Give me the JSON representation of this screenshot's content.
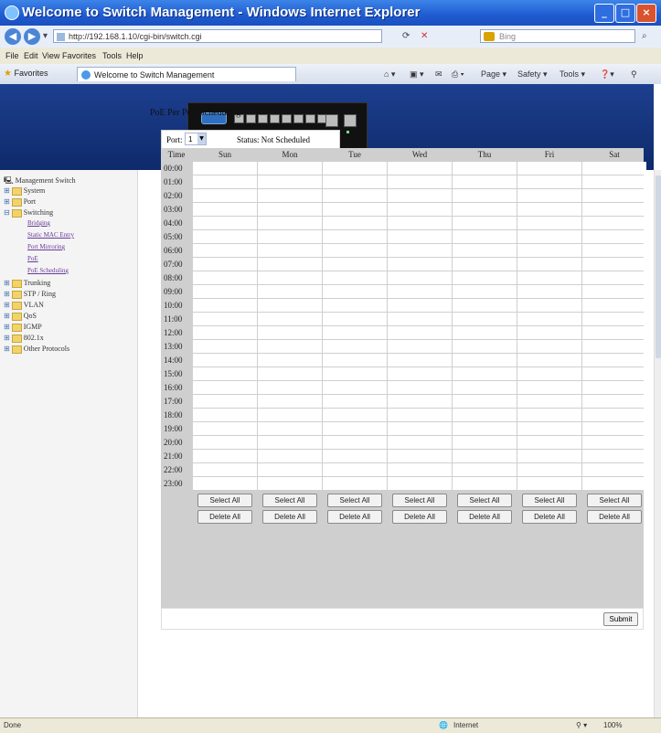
{
  "window": {
    "title": "Welcome to Switch Management - Windows Internet Explorer"
  },
  "address_bar": {
    "url": "http://192.168.1.10/cgi-bin/switch.cgi",
    "search_placeholder": "Bing"
  },
  "menu": [
    "File",
    "Edit",
    "View",
    "Favorites",
    "Tools",
    "Help"
  ],
  "favorites_bar": {
    "favorites_label": "Favorites",
    "tab_title": "Welcome to Switch Management"
  },
  "command_bar": [
    "Page ▾",
    "Safety ▾",
    "Tools ▾"
  ],
  "sidebar": {
    "root": "Management Switch",
    "folders": [
      "System",
      "Port",
      "Switching",
      "Trunking",
      "STP / Ring",
      "VLAN",
      "QoS",
      "IGMP",
      "802.1x",
      "Other Protocols"
    ],
    "switching_children": [
      "Bridging",
      "Static MAC Entry",
      "Port Mirroring",
      "PoE",
      "PoE Scheduling"
    ]
  },
  "main": {
    "heading": "PoE Per Port Scheduling",
    "port_label": "Port:",
    "port_value": "1",
    "status_text": "Status: Not Scheduled",
    "time_header": "Time",
    "days": [
      "Sun",
      "Mon",
      "Tue",
      "Wed",
      "Thu",
      "Fri",
      "Sat"
    ],
    "hours": [
      "00:00",
      "01:00",
      "02:00",
      "03:00",
      "04:00",
      "05:00",
      "06:00",
      "07:00",
      "08:00",
      "09:00",
      "10:00",
      "11:00",
      "12:00",
      "13:00",
      "14:00",
      "15:00",
      "16:00",
      "17:00",
      "18:00",
      "19:00",
      "20:00",
      "21:00",
      "22:00",
      "23:00"
    ],
    "select_all_label": "Select All",
    "delete_all_label": "Delete All",
    "submit_label": "Submit"
  },
  "statusbar": {
    "left": "Done",
    "zone": "Internet",
    "zoom": "100%"
  }
}
